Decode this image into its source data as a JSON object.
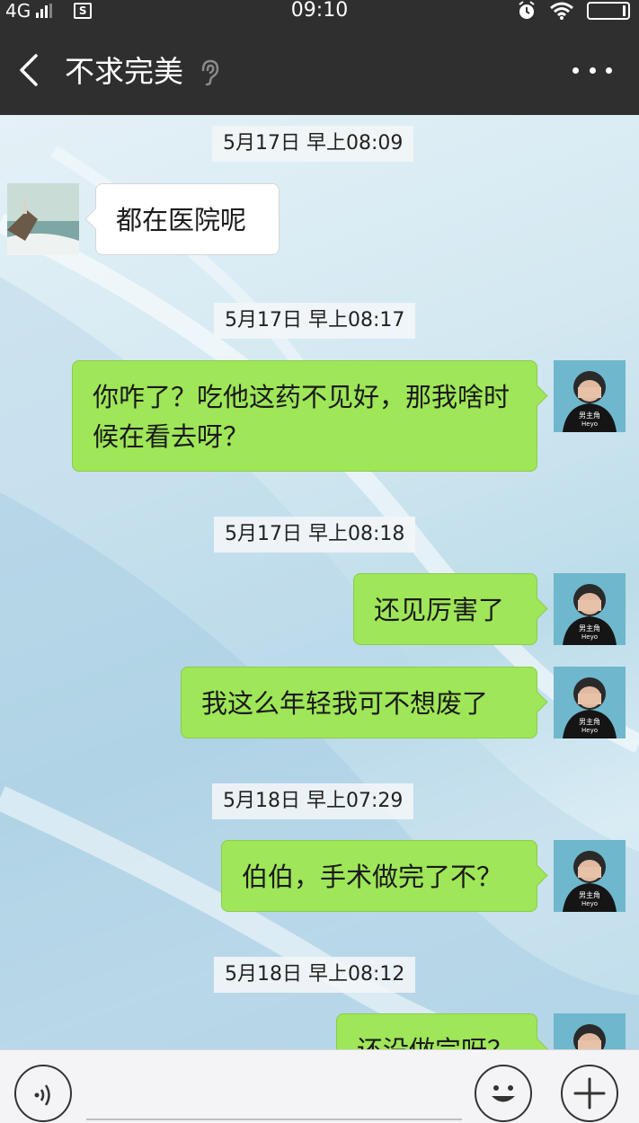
{
  "status_bar": {
    "network": "4G",
    "time": "09:10",
    "sim_icon_label": "S"
  },
  "header": {
    "title": "不求完美",
    "icons": [
      "back-arrow-icon",
      "ear-icon",
      "more-dots-icon"
    ]
  },
  "messages": [
    {
      "type": "timestamp",
      "text": "5月17日 早上08:09"
    },
    {
      "type": "message",
      "side": "left",
      "text": "都在医院呢"
    },
    {
      "type": "timestamp",
      "text": "5月17日 早上08:17"
    },
    {
      "type": "message",
      "side": "right",
      "text": "你咋了？吃他这药不见好，那我啥时候在看去呀？"
    },
    {
      "type": "timestamp",
      "text": "5月17日 早上08:18"
    },
    {
      "type": "message",
      "side": "right",
      "text": "还见厉害了"
    },
    {
      "type": "message",
      "side": "right",
      "text": "我这么年轻我可不想废了"
    },
    {
      "type": "timestamp",
      "text": "5月18日 早上07:29"
    },
    {
      "type": "message",
      "side": "right",
      "text": "伯伯，手术做完了不？"
    },
    {
      "type": "timestamp",
      "text": "5月18日 早上08:12"
    },
    {
      "type": "message",
      "side": "right",
      "text": "还没做完呀？"
    }
  ],
  "avatar_right": {
    "caption_top": "男主角",
    "caption_bottom": "Heyo"
  },
  "input_bar": {
    "icons": [
      "voice-icon",
      "emoji-icon",
      "plus-icon"
    ]
  },
  "colors": {
    "header_bg": "#2f2f2f",
    "bubble_right": "#9fe658",
    "bubble_left": "#ffffff"
  }
}
